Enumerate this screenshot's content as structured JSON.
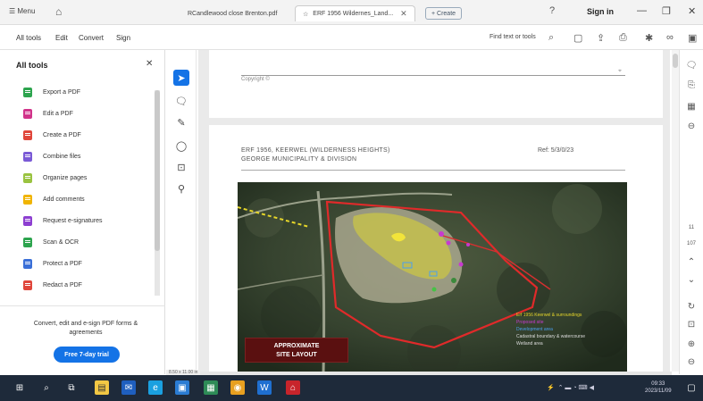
{
  "titlebar": {
    "menu_label": "☰ Menu",
    "tabs": [
      {
        "label": "RCandlewood close Brenton.pdf",
        "active": false
      },
      {
        "label": "ERF 1956 Wildernes_Land...",
        "active": true
      }
    ],
    "new_tab_label": "+ Create",
    "sign_in": "Sign in"
  },
  "menubar": {
    "items": [
      "All tools",
      "Edit",
      "Convert",
      "Sign"
    ],
    "find_text": "Find text or tools"
  },
  "tools_pane": {
    "heading": "All tools",
    "items": [
      {
        "label": "Export a PDF",
        "color": "#2da44e"
      },
      {
        "label": "Edit a PDF",
        "color": "#d1338a"
      },
      {
        "label": "Create a PDF",
        "color": "#e0463b"
      },
      {
        "label": "Combine files",
        "color": "#7a5ad6"
      },
      {
        "label": "Organize pages",
        "color": "#9ac340"
      },
      {
        "label": "Add comments",
        "color": "#f0b400"
      },
      {
        "label": "Request e-signatures",
        "color": "#8d3fd1"
      },
      {
        "label": "Scan & OCR",
        "color": "#2da44e"
      },
      {
        "label": "Protect a PDF",
        "color": "#3a6fd8"
      },
      {
        "label": "Redact a PDF",
        "color": "#e0463b"
      }
    ],
    "promo_text": "Convert, edit and e-sign PDF forms & agreements",
    "trial_button": "Free 7-day trial"
  },
  "document": {
    "copyright": "Copyright ©",
    "erf_title": "ERF 1956, KEERWEL (WILDERNESS HEIGHTS)",
    "municipality": "GEORGE MUNICIPALITY & DIVISION",
    "ref": "Ref: 5/3/0/23",
    "approx_label_1": "APPROXIMATE",
    "approx_label_2": "SITE LAYOUT",
    "legend": [
      {
        "text": "Erf 1956 Keerwel & surroundings",
        "color": "#e6d62a"
      },
      {
        "text": "Proposed site",
        "color": "#c83ad0"
      },
      {
        "text": "Development area",
        "color": "#4aa0f0"
      },
      {
        "text": "Cadastral boundary & watercourse",
        "color": "#dddddd"
      },
      {
        "text": "Wetland area",
        "color": "#dddddd"
      }
    ]
  },
  "status": {
    "page_size": "8.50 x 11.00 in"
  },
  "taskbar": {
    "time": "09:33",
    "date": "2023/11/09"
  }
}
